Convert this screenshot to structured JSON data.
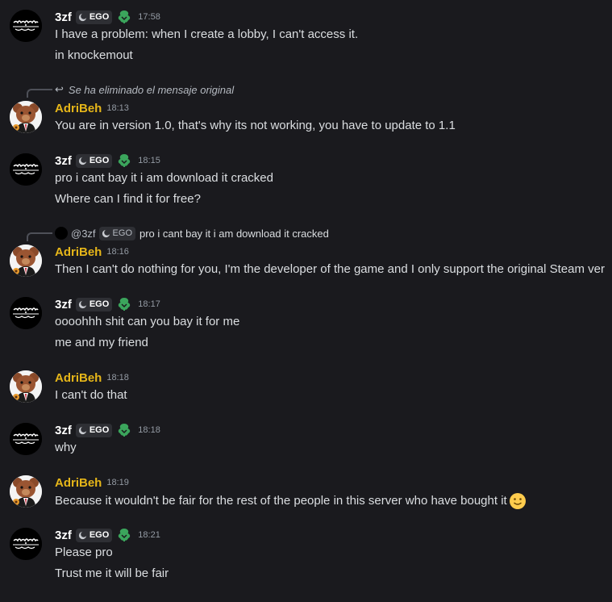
{
  "messages": [
    {
      "author": "3zf",
      "tag": "EGO",
      "time": "17:58",
      "lines": [
        "I have a problem: when I create a lobby, I can't access it.",
        "in knockemout"
      ]
    },
    {
      "reply": {
        "deleted_text": "Se ha eliminado el mensaje original"
      },
      "author": "AdriBeh",
      "time": "18:13",
      "lines": [
        "You are in version 1.0, that's why its not working, you have to update to 1.1"
      ]
    },
    {
      "author": "3zf",
      "tag": "EGO",
      "time": "18:15",
      "lines": [
        "pro i cant bay it i am download it cracked",
        "Where can I find it for free?"
      ]
    },
    {
      "reply": {
        "mention": "@3zf",
        "tag": "EGO",
        "text": "pro i cant bay it i am download it cracked"
      },
      "author": "AdriBeh",
      "time": "18:16",
      "lines": [
        "Then I can't do nothing for you, I'm the developer of the game and I only support the original Steam ver"
      ]
    },
    {
      "author": "3zf",
      "tag": "EGO",
      "time": "18:17",
      "lines": [
        "oooohhh shit can you bay it for me",
        "me and my friend"
      ]
    },
    {
      "author": "AdriBeh",
      "time": "18:18",
      "lines": [
        "I can't do that"
      ]
    },
    {
      "author": "3zf",
      "tag": "EGO",
      "time": "18:18",
      "lines": [
        "why"
      ]
    },
    {
      "author": "AdriBeh",
      "time": "18:19",
      "lines": [
        "Because it wouldn't be fair for the rest of the people in this server who have bought it"
      ],
      "emoji": "slightly-smiling-face"
    },
    {
      "author": "3zf",
      "tag": "EGO",
      "time": "18:21",
      "lines": [
        "Please pro",
        "Trust me it will be fair"
      ]
    }
  ],
  "colors": {
    "background": "#1a1a1e",
    "author_3zf": "#ffffff",
    "author_adribeh": "#e6b619",
    "tag_bg": "#2e2f34",
    "timestamp": "#949ba4",
    "badge_green": "#3ba55c"
  }
}
